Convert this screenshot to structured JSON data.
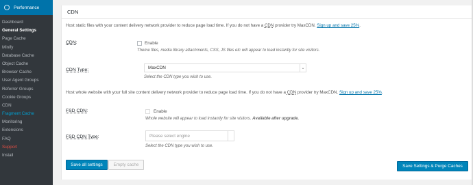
{
  "sidebar": {
    "header": "Performance",
    "items": [
      {
        "label": "Dashboard",
        "style": "normal"
      },
      {
        "label": "General Settings",
        "style": "bold"
      },
      {
        "label": "Page Cache",
        "style": "normal"
      },
      {
        "label": "Minify",
        "style": "normal"
      },
      {
        "label": "Database Cache",
        "style": "normal"
      },
      {
        "label": "Object Cache",
        "style": "normal"
      },
      {
        "label": "Browser Cache",
        "style": "normal"
      },
      {
        "label": "User Agent Groups",
        "style": "normal"
      },
      {
        "label": "Referrer Groups",
        "style": "normal"
      },
      {
        "label": "Cookie Groups",
        "style": "normal"
      },
      {
        "label": "CDN",
        "style": "normal"
      },
      {
        "label": "Fragment Cache",
        "style": "blue"
      },
      {
        "label": "Monitoring",
        "style": "normal"
      },
      {
        "label": "Extensions",
        "style": "normal"
      },
      {
        "label": "FAQ",
        "style": "normal"
      },
      {
        "label": "Support",
        "style": "red"
      },
      {
        "label": "Install",
        "style": "normal"
      }
    ]
  },
  "panel": {
    "title": "CDN",
    "cdn_desc": {
      "before": "Host static files with your content delivery network provider to reduce page load time. If you do not have a ",
      "abbr": "CDN",
      "after": " provider try MaxCDN. ",
      "link": "Sign up and save 25%",
      "end": "."
    },
    "cdn_label": "CDN:",
    "cdn_checkbox_label": "Enable",
    "cdn_note": "Theme files, media library attachments, CSS, JS files etc will appear to load instantly for site visitors.",
    "cdn_type_label": "CDN Type:",
    "cdn_type_value": "MaxCDN",
    "cdn_type_note": "Select the CDN type you wish to use.",
    "fsd_desc": {
      "before": "Host whole website with your full site content delivery network provider to reduce page load time. If you do not have a ",
      "abbr": "CDN",
      "after": " provider try MaxCDN. ",
      "link": "Sign up and save 25%",
      "end": "."
    },
    "fsd_label": "FSD CDN:",
    "fsd_checkbox_label": "Enable",
    "fsd_note_text": "Whole website will appear to load instantly for site visitors. ",
    "fsd_note_bold": "Available after upgrade.",
    "fsd_type_label": "FSD CDN Type:",
    "fsd_type_placeholder": "Please select engine",
    "fsd_type_note": "Select the CDN type you wish to use.",
    "save_all_label": "Save all settings",
    "empty_cache_label": "Empty cache",
    "save_purge_label": "Save Settings & Purge Caches"
  },
  "colors": {
    "sidebar_bg": "#23282d",
    "header_accent": "#0073aa",
    "primary_button": "#0085ba",
    "link": "#0073aa"
  }
}
